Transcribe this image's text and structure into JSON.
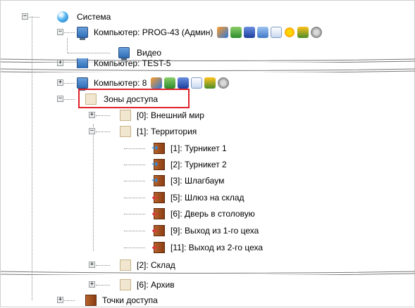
{
  "tree": {
    "root": {
      "label": "Система",
      "icon": "globe-icon"
    },
    "computer1": {
      "label": "Компьютер: PROG-43 (Админ)"
    },
    "video": {
      "label": "Видео"
    },
    "computer_partial": {
      "label": "Компьютер: TEST-5"
    },
    "computer3": {
      "label": "Компьютер: 8"
    },
    "zones": {
      "label": "Зоны доступа"
    },
    "zone0": {
      "label": "[0]: Внешний мир"
    },
    "zone1": {
      "label": "[1]: Территория"
    },
    "points": [
      {
        "label": "[1]: Турникет 1",
        "dir": "in"
      },
      {
        "label": "[2]: Турникет 2",
        "dir": "in"
      },
      {
        "label": "[3]: Шлагбаум",
        "dir": "in"
      },
      {
        "label": "[5]: Шлюз на склад",
        "dir": "out"
      },
      {
        "label": "[6]: Дверь в столовую",
        "dir": "out"
      },
      {
        "label": "[9]: Выход из 1-го цеха",
        "dir": "out"
      },
      {
        "label": "[11]: Выход из 2-го цеха",
        "dir": "out"
      }
    ],
    "zone2": {
      "label": "[2]: Склад"
    },
    "zone6": {
      "label": "[6]: Архив"
    },
    "access_points": {
      "label": "Точки доступа"
    }
  },
  "colors": {
    "highlight": "#e0202a",
    "selection_border": "#e0202a"
  }
}
